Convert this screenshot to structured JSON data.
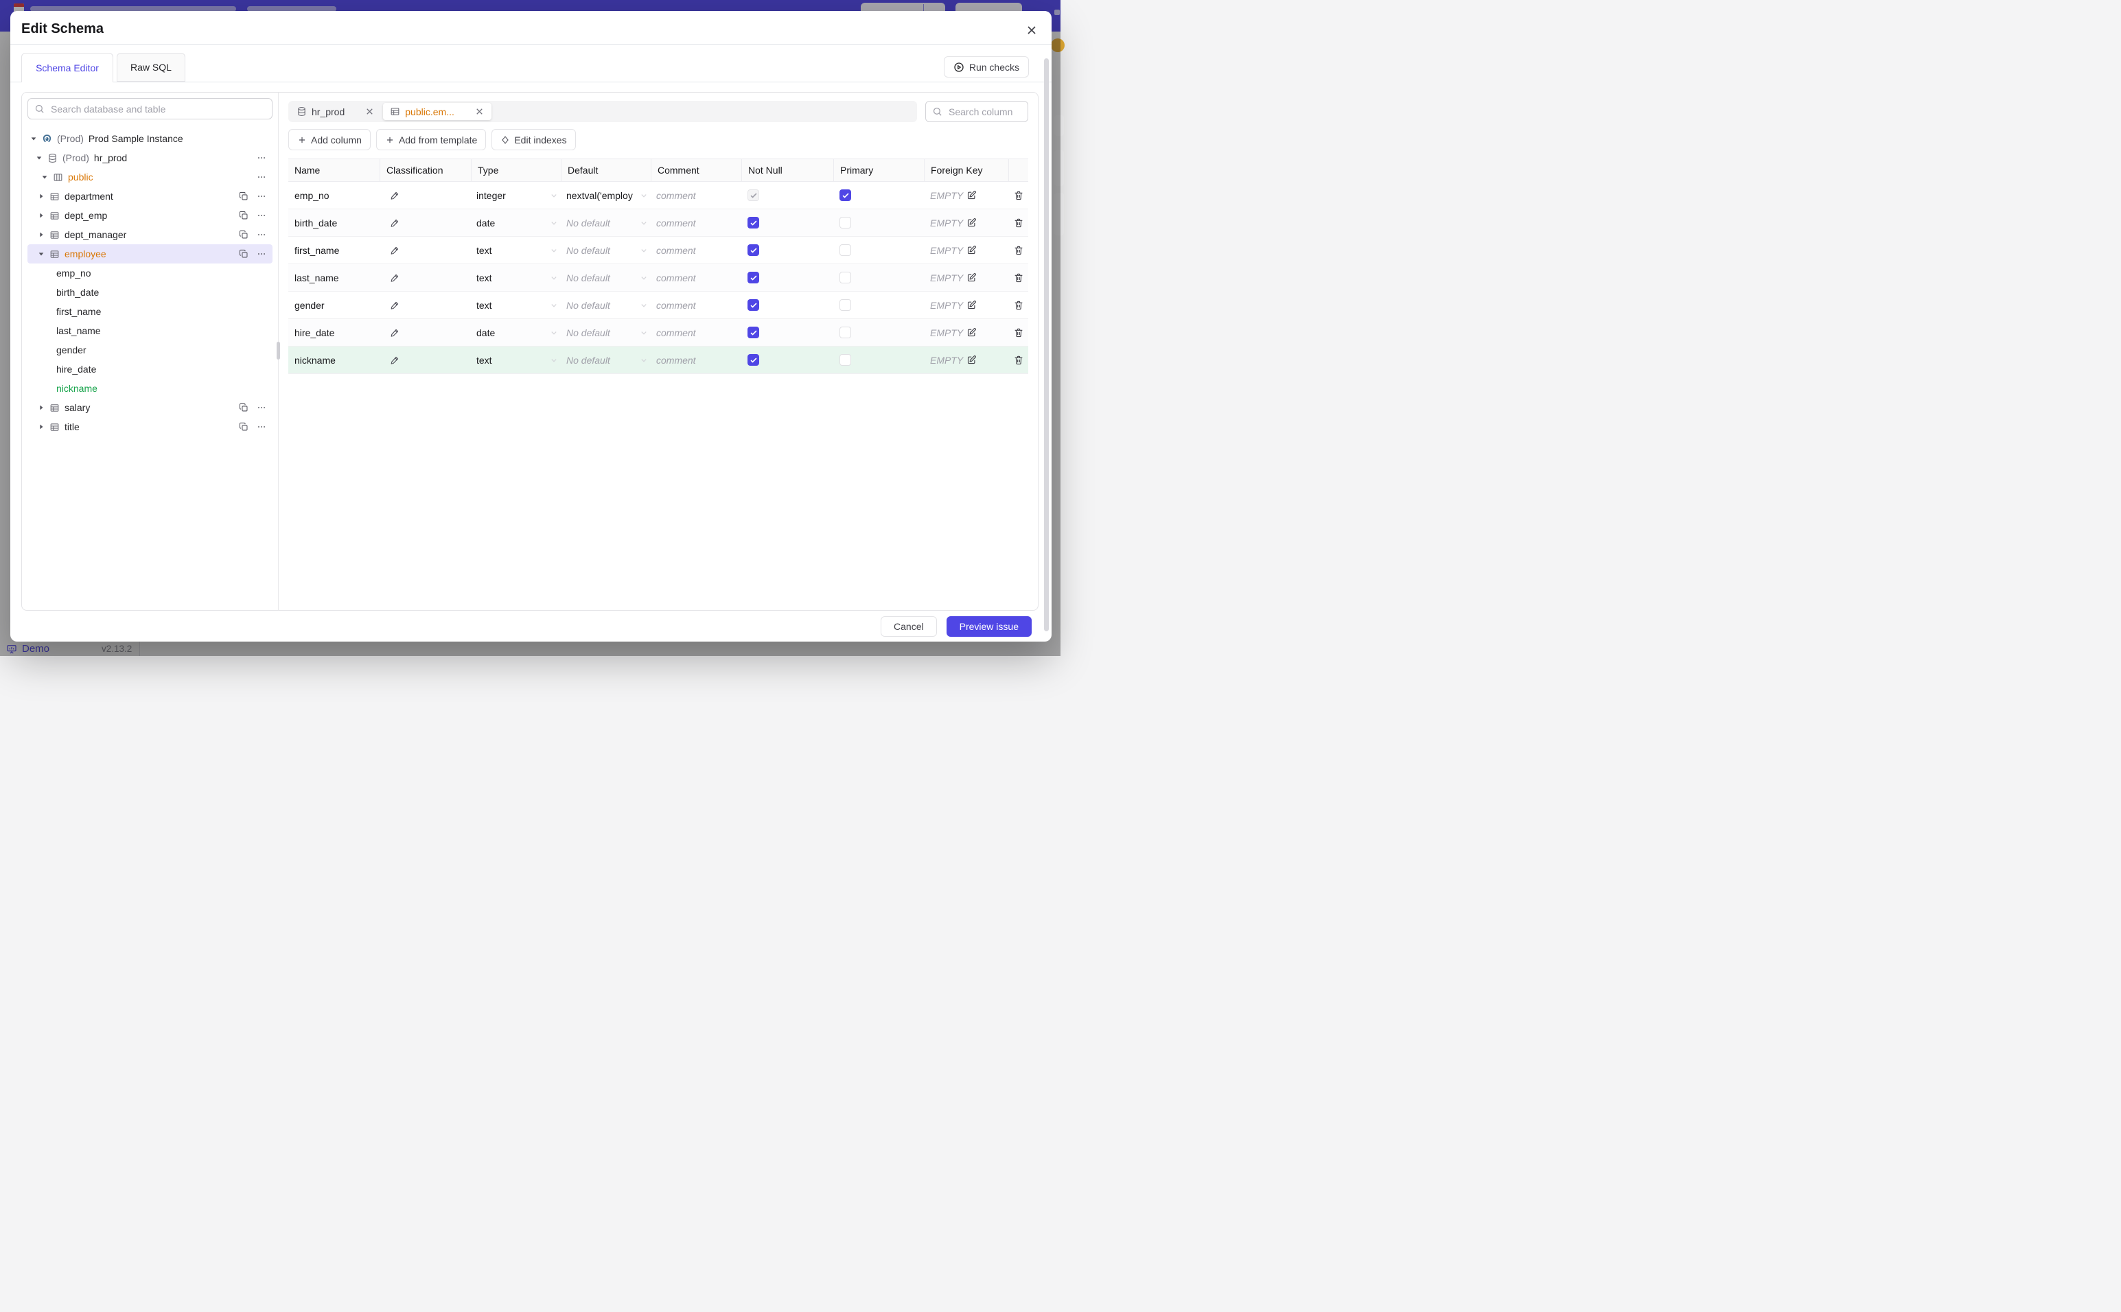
{
  "background": {
    "demo_label": "Demo",
    "version": "v2.13.2",
    "topbar_color": "#4f46e5"
  },
  "modal": {
    "title": "Edit Schema",
    "tabs": [
      {
        "label": "Schema Editor",
        "active": true
      },
      {
        "label": "Raw SQL",
        "active": false
      }
    ],
    "run_checks_label": "Run checks",
    "sidebar": {
      "search_placeholder": "Search database and table",
      "tree": [
        {
          "label": "Prod Sample Instance",
          "prefix": "(Prod)",
          "icon": "postgres",
          "caret": "open",
          "indent": 4
        },
        {
          "label": "hr_prod",
          "prefix": "(Prod)",
          "icon": "database",
          "caret": "open",
          "indent": 12,
          "dots": true
        },
        {
          "label": "public",
          "icon": "schema",
          "caret": "open",
          "indent": 20,
          "color": "orange",
          "dots": true
        },
        {
          "label": "department",
          "icon": "table-grid",
          "caret": "closed",
          "indent": 15,
          "copy": true,
          "dots": true
        },
        {
          "label": "dept_emp",
          "icon": "table-grid",
          "caret": "closed",
          "indent": 15,
          "copy": true,
          "dots": true
        },
        {
          "label": "dept_manager",
          "icon": "table-grid",
          "caret": "closed",
          "indent": 15,
          "copy": true,
          "dots": true
        },
        {
          "label": "employee",
          "icon": "table-grid",
          "caret": "open",
          "indent": 15,
          "color": "orange",
          "selected": true,
          "copy": true,
          "dots": true
        },
        {
          "label": "emp_no",
          "column": true,
          "indent": 42
        },
        {
          "label": "birth_date",
          "column": true,
          "indent": 42
        },
        {
          "label": "first_name",
          "column": true,
          "indent": 42
        },
        {
          "label": "last_name",
          "column": true,
          "indent": 42
        },
        {
          "label": "gender",
          "column": true,
          "indent": 42
        },
        {
          "label": "hire_date",
          "column": true,
          "indent": 42
        },
        {
          "label": "nickname",
          "column": true,
          "indent": 42,
          "color": "green"
        },
        {
          "label": "salary",
          "icon": "table-grid",
          "caret": "closed",
          "indent": 15,
          "copy": true,
          "dots": true
        },
        {
          "label": "title",
          "icon": "table-grid",
          "caret": "closed",
          "indent": 15,
          "copy": true,
          "dots": true
        }
      ]
    },
    "editor": {
      "open_tabs": [
        {
          "label": "hr_prod",
          "icon": "database",
          "active": false,
          "modified": false
        },
        {
          "label": "public.em...",
          "icon": "table-grid",
          "active": true,
          "modified": true
        }
      ],
      "column_search_placeholder": "Search column",
      "actions": [
        {
          "label": "Add column",
          "icon": "plus"
        },
        {
          "label": "Add from template",
          "icon": "plus"
        },
        {
          "label": "Edit indexes",
          "icon": "diamond"
        }
      ],
      "table": {
        "headers": [
          "Name",
          "Classification",
          "Type",
          "Default",
          "Comment",
          "Not Null",
          "Primary",
          "Foreign Key",
          ""
        ],
        "no_default_placeholder": "No default",
        "comment_placeholder": "comment",
        "fk_empty_label": "EMPTY",
        "rows": [
          {
            "name": "emp_no",
            "type": "integer",
            "default": "nextval('employ",
            "not_null_checked": true,
            "not_null_disabled": true,
            "primary_checked": true,
            "status": "normal"
          },
          {
            "name": "birth_date",
            "type": "date",
            "default": null,
            "not_null_checked": true,
            "not_null_disabled": false,
            "primary_checked": false,
            "status": "normal"
          },
          {
            "name": "first_name",
            "type": "text",
            "default": null,
            "not_null_checked": true,
            "not_null_disabled": false,
            "primary_checked": false,
            "status": "normal"
          },
          {
            "name": "last_name",
            "type": "text",
            "default": null,
            "not_null_checked": true,
            "not_null_disabled": false,
            "primary_checked": false,
            "status": "normal"
          },
          {
            "name": "gender",
            "type": "text",
            "default": null,
            "not_null_checked": true,
            "not_null_disabled": false,
            "primary_checked": false,
            "status": "normal"
          },
          {
            "name": "hire_date",
            "type": "date",
            "default": null,
            "not_null_checked": true,
            "not_null_disabled": false,
            "primary_checked": false,
            "status": "normal"
          },
          {
            "name": "nickname",
            "type": "text",
            "default": null,
            "not_null_checked": true,
            "not_null_disabled": false,
            "primary_checked": false,
            "status": "created"
          }
        ]
      }
    },
    "footer": {
      "cancel_label": "Cancel",
      "submit_label": "Preview issue"
    }
  },
  "colors": {
    "accent": "#4f46e5",
    "modified_orange": "#d97706",
    "created_green": "#16a34a",
    "created_row_bg": "#e8f6ee",
    "selected_tree_bg": "#e9e7fb"
  }
}
